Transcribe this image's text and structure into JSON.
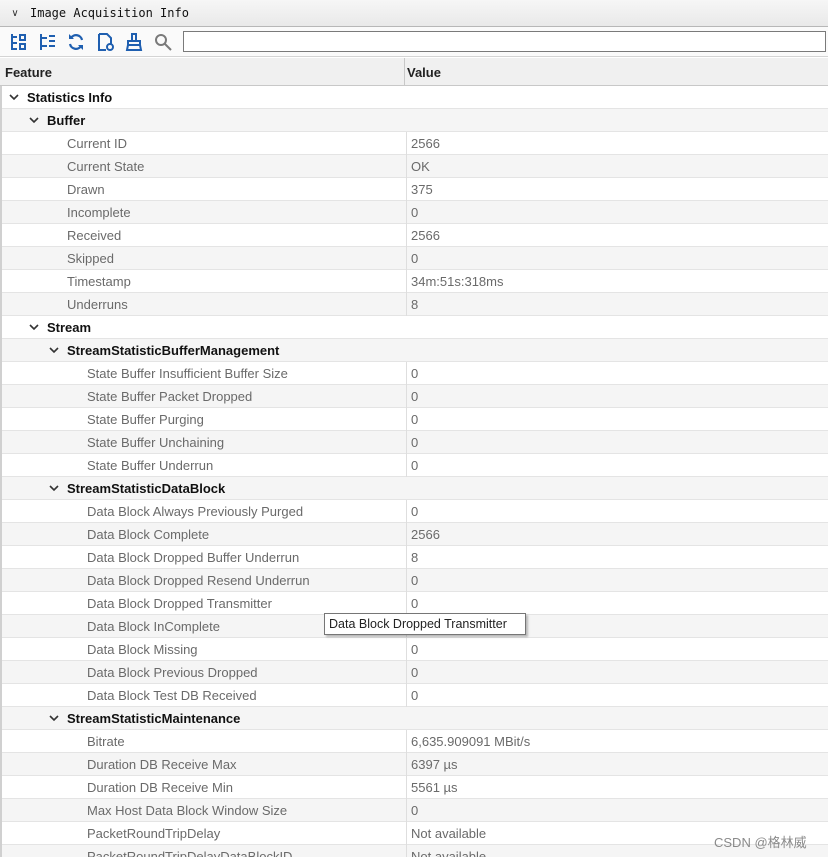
{
  "window": {
    "title": "Image Acquisition Info"
  },
  "toolbar": {
    "icons": [
      "expand-all-icon",
      "collapse-all-icon",
      "refresh-icon",
      "export-icon",
      "clear-icon",
      "search-icon"
    ],
    "search": {
      "value": "",
      "placeholder": ""
    }
  },
  "columns": {
    "feature": "Feature",
    "value": "Value"
  },
  "rows": [
    {
      "level": 0,
      "group": true,
      "feature": "Statistics Info",
      "value": ""
    },
    {
      "level": 1,
      "group": true,
      "feature": "Buffer",
      "value": ""
    },
    {
      "level": 2,
      "group": false,
      "feature": "Current ID",
      "value": "2566"
    },
    {
      "level": 2,
      "group": false,
      "feature": "Current State",
      "value": "OK"
    },
    {
      "level": 2,
      "group": false,
      "feature": "Drawn",
      "value": "375"
    },
    {
      "level": 2,
      "group": false,
      "feature": "Incomplete",
      "value": "0"
    },
    {
      "level": 2,
      "group": false,
      "feature": "Received",
      "value": "2566"
    },
    {
      "level": 2,
      "group": false,
      "feature": "Skipped",
      "value": "0"
    },
    {
      "level": 2,
      "group": false,
      "feature": "Timestamp",
      "value": "34m:51s:318ms"
    },
    {
      "level": 2,
      "group": false,
      "feature": "Underruns",
      "value": "8"
    },
    {
      "level": 1,
      "group": true,
      "feature": "Stream",
      "value": ""
    },
    {
      "level": 2,
      "group": true,
      "feature": "StreamStatisticBufferManagement",
      "value": ""
    },
    {
      "level": 3,
      "group": false,
      "feature": "State Buffer Insufficient Buffer Size",
      "value": "0"
    },
    {
      "level": 3,
      "group": false,
      "feature": "State Buffer Packet Dropped",
      "value": "0"
    },
    {
      "level": 3,
      "group": false,
      "feature": "State Buffer Purging",
      "value": "0"
    },
    {
      "level": 3,
      "group": false,
      "feature": "State Buffer Unchaining",
      "value": "0"
    },
    {
      "level": 3,
      "group": false,
      "feature": "State Buffer Underrun",
      "value": "0"
    },
    {
      "level": 2,
      "group": true,
      "feature": "StreamStatisticDataBlock",
      "value": ""
    },
    {
      "level": 3,
      "group": false,
      "feature": "Data Block Always Previously Purged",
      "value": "0"
    },
    {
      "level": 3,
      "group": false,
      "feature": "Data Block Complete",
      "value": "2566"
    },
    {
      "level": 3,
      "group": false,
      "feature": "Data Block Dropped Buffer Underrun",
      "value": "8"
    },
    {
      "level": 3,
      "group": false,
      "feature": "Data Block Dropped Resend Underrun",
      "value": "0"
    },
    {
      "level": 3,
      "group": false,
      "feature": "Data Block Dropped Transmitter",
      "value": "0"
    },
    {
      "level": 3,
      "group": false,
      "feature": "Data Block InComplete",
      "value": ""
    },
    {
      "level": 3,
      "group": false,
      "feature": "Data Block Missing",
      "value": "0"
    },
    {
      "level": 3,
      "group": false,
      "feature": "Data Block Previous Dropped",
      "value": "0"
    },
    {
      "level": 3,
      "group": false,
      "feature": "Data Block Test DB Received",
      "value": "0"
    },
    {
      "level": 2,
      "group": true,
      "feature": "StreamStatisticMaintenance",
      "value": ""
    },
    {
      "level": 3,
      "group": false,
      "feature": "Bitrate",
      "value": "6,635.909091 MBit/s"
    },
    {
      "level": 3,
      "group": false,
      "feature": "Duration DB Receive Max",
      "value": "6397 µs"
    },
    {
      "level": 3,
      "group": false,
      "feature": "Duration DB Receive Min",
      "value": "5561 µs"
    },
    {
      "level": 3,
      "group": false,
      "feature": "Max Host Data Block Window Size",
      "value": "0"
    },
    {
      "level": 3,
      "group": false,
      "feature": "PacketRoundTripDelay",
      "value": "Not available"
    },
    {
      "level": 3,
      "group": false,
      "feature": "PacketRoundTripDelayDataBlockID",
      "value": "Not available"
    }
  ],
  "tooltip": {
    "text": "Data Block Dropped Transmitter"
  },
  "watermark": {
    "text": "CSDN @格林威"
  },
  "colors": {
    "icon_blue": "#1f5fb0",
    "row_alt": "#f5f5f5",
    "grid_line": "#e4e4e4"
  }
}
